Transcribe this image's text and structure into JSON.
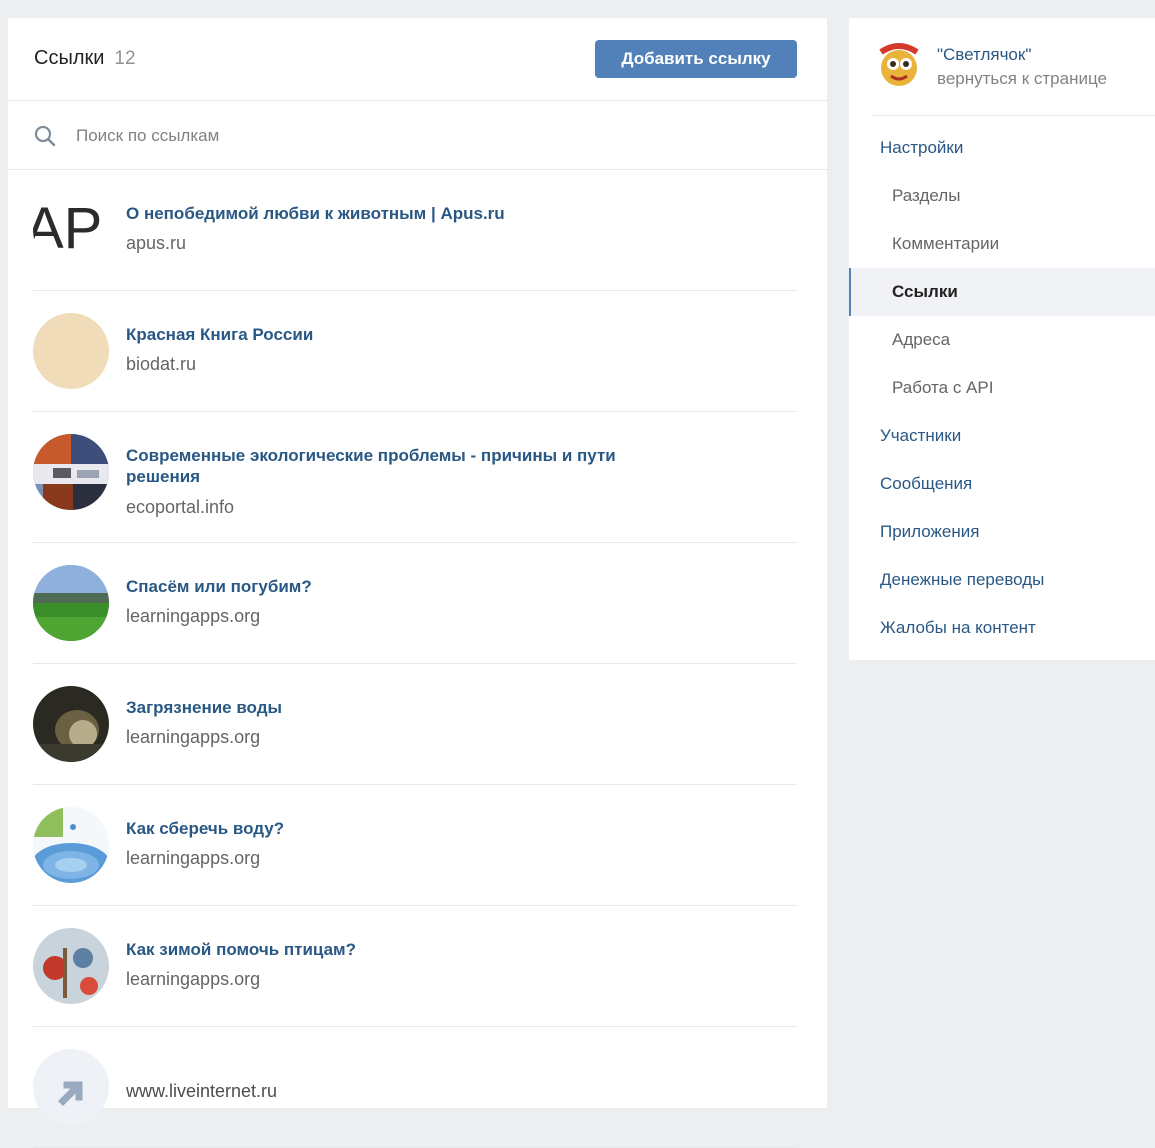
{
  "header": {
    "title": "Ссылки",
    "count": "12",
    "add_button": "Добавить ссылку"
  },
  "search": {
    "placeholder": "Поиск по ссылкам",
    "icon": "search-icon"
  },
  "links": [
    {
      "title": "О непобедимой любви к животным | Apus.ru",
      "domain": "apus.ru"
    },
    {
      "title": "Красная Книга России",
      "domain": "biodat.ru"
    },
    {
      "title": "Современные экологические проблемы - причины и пути решения",
      "domain": "ecoportal.info"
    },
    {
      "title": "Спасём или погубим?",
      "domain": "learningapps.org"
    },
    {
      "title": "Загрязнение воды",
      "domain": "learningapps.org"
    },
    {
      "title": "Как сберечь воду?",
      "domain": "learningapps.org"
    },
    {
      "title": "Как зимой помочь птицам?",
      "domain": "learningapps.org"
    },
    {
      "title": "",
      "domain": "www.liveinternet.ru"
    }
  ],
  "thumb_texts": {
    "apus_logo": "AP"
  },
  "sidebar": {
    "group_name": "\"Светлячок\"",
    "back_link": "вернуться к странице",
    "menu": [
      {
        "label": "Настройки",
        "level": "top"
      },
      {
        "label": "Разделы",
        "level": "sub"
      },
      {
        "label": "Комментарии",
        "level": "sub"
      },
      {
        "label": "Ссылки",
        "level": "sub",
        "active": true
      },
      {
        "label": "Адреса",
        "level": "sub"
      },
      {
        "label": "Работа с API",
        "level": "sub"
      },
      {
        "label": "Участники",
        "level": "top"
      },
      {
        "label": "Сообщения",
        "level": "top"
      },
      {
        "label": "Приложения",
        "level": "top"
      },
      {
        "label": "Денежные переводы",
        "level": "top"
      },
      {
        "label": "Жалобы на контент",
        "level": "top"
      }
    ]
  },
  "colors": {
    "accent": "#5181b8",
    "link": "#2a5885",
    "background": "#edeef0"
  }
}
